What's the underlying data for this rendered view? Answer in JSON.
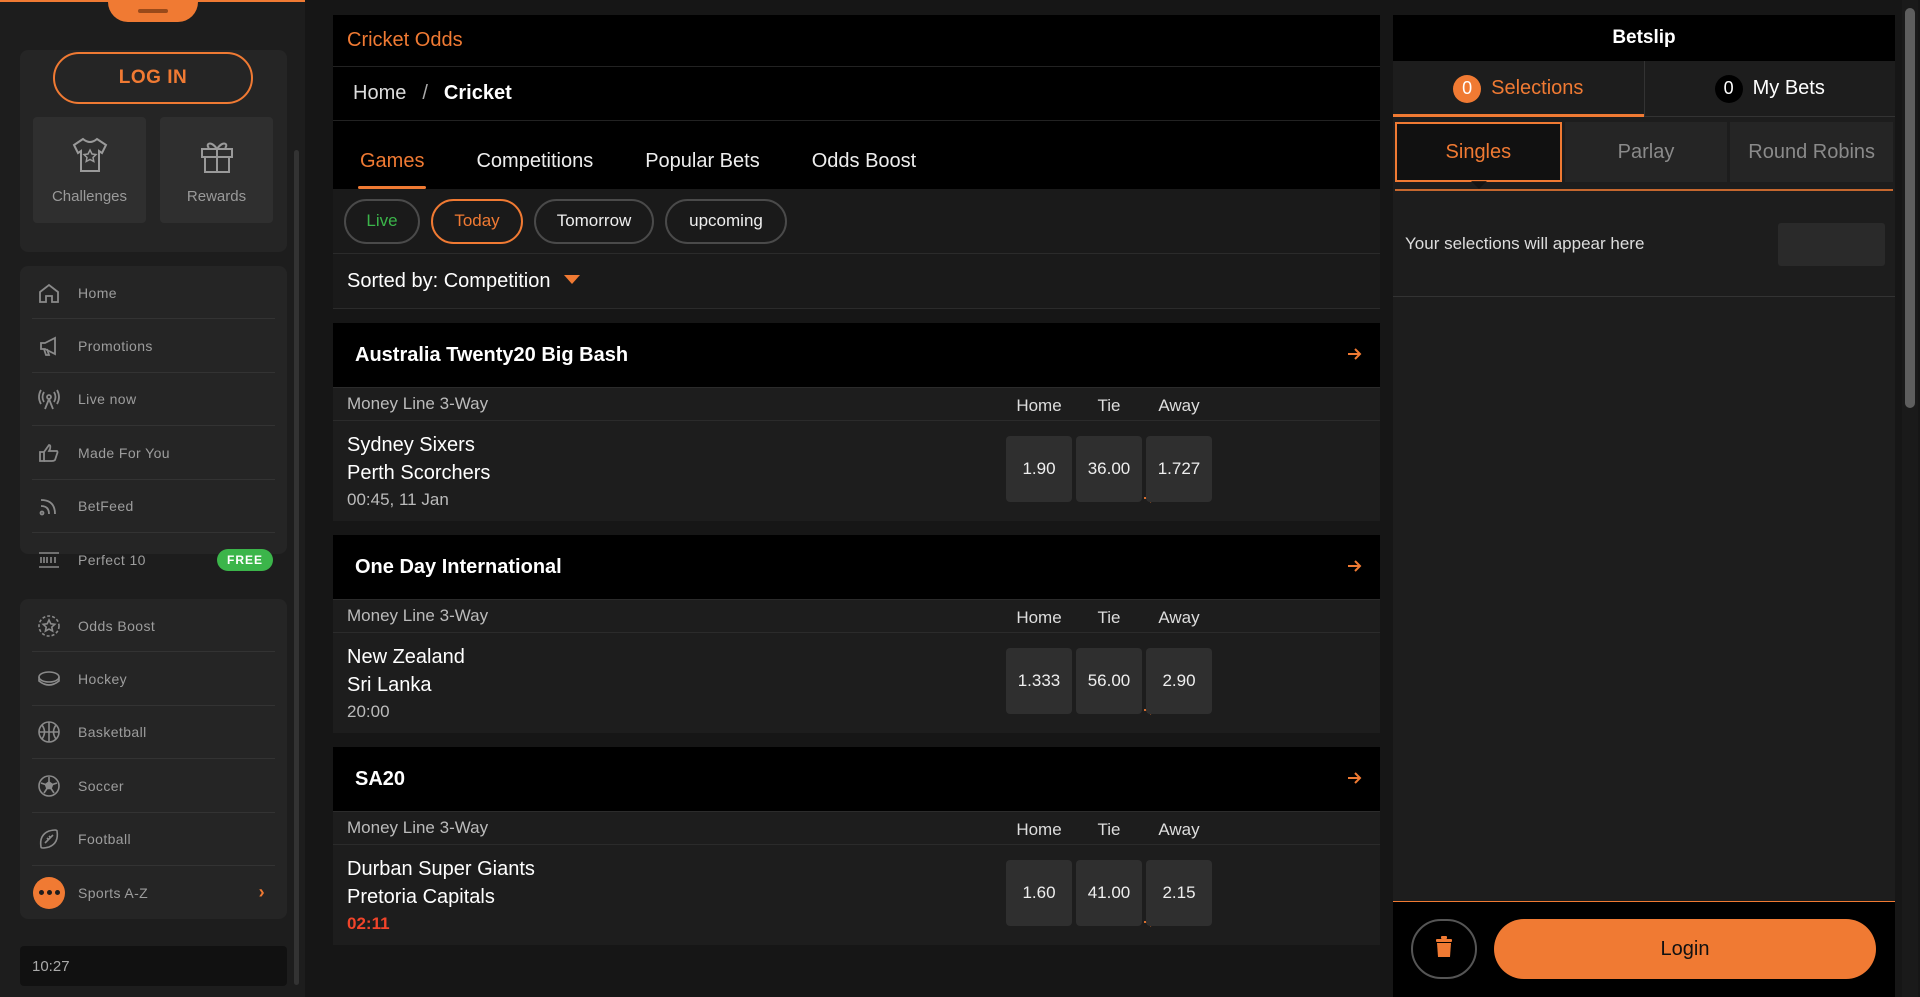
{
  "sidebar": {
    "login_label": "LOG IN",
    "tiles": [
      {
        "label": "Challenges",
        "icon": "shirt-icon"
      },
      {
        "label": "Rewards",
        "icon": "gift-icon"
      }
    ],
    "nav_primary": [
      {
        "label": "Home",
        "icon": "home-icon"
      },
      {
        "label": "Promotions",
        "icon": "megaphone-icon"
      },
      {
        "label": "Live now",
        "icon": "broadcast-icon"
      },
      {
        "label": "Made For You",
        "icon": "thumbs-up-icon"
      },
      {
        "label": "BetFeed",
        "icon": "rss-icon"
      },
      {
        "label": "Perfect 10",
        "icon": "perfect10-icon",
        "badge": "FREE"
      }
    ],
    "nav_sports": [
      {
        "label": "Odds Boost",
        "icon": "odds-boost-icon"
      },
      {
        "label": "Hockey",
        "icon": "hockey-icon"
      },
      {
        "label": "Basketball",
        "icon": "basketball-icon"
      },
      {
        "label": "Soccer",
        "icon": "soccer-icon"
      },
      {
        "label": "Football",
        "icon": "football-icon"
      },
      {
        "label": "Sports A-Z",
        "icon": "more-dots-icon"
      }
    ],
    "clock": "10:27"
  },
  "main": {
    "title": "Cricket Odds",
    "breadcrumb": {
      "home": "Home",
      "sep": "/",
      "current": "Cricket"
    },
    "tabs": [
      "Games",
      "Competitions",
      "Popular Bets",
      "Odds Boost"
    ],
    "filters": [
      "Live",
      "Today",
      "Tomorrow",
      "upcoming"
    ],
    "sort_label": "Sorted by: Competition",
    "competitions": [
      {
        "name": "Australia Twenty20 Big Bash",
        "market": "Money Line 3-Way",
        "cols": [
          "Home",
          "Tie",
          "Away"
        ],
        "home_team": "Sydney Sixers",
        "away_team": "Perth Scorchers",
        "time": "00:45, 11 Jan",
        "odds": [
          "1.90",
          "36.00",
          "1.727"
        ]
      },
      {
        "name": "One Day International",
        "market": "Money Line 3-Way",
        "cols": [
          "Home",
          "Tie",
          "Away"
        ],
        "home_team": "New Zealand",
        "away_team": "Sri Lanka",
        "time": "20:00",
        "odds": [
          "1.333",
          "56.00",
          "2.90"
        ]
      },
      {
        "name": "SA20",
        "market": "Money Line 3-Way",
        "cols": [
          "Home",
          "Tie",
          "Away"
        ],
        "home_team": "Durban Super Giants",
        "away_team": "Pretoria Capitals",
        "time": "02:11",
        "odds": [
          "1.60",
          "41.00",
          "2.15"
        ]
      }
    ]
  },
  "betslip": {
    "title": "Betslip",
    "tabs": [
      {
        "count": "0",
        "label": "Selections"
      },
      {
        "count": "0",
        "label": "My Bets"
      }
    ],
    "bet_types": [
      "Singles",
      "Parlay",
      "Round Robins"
    ],
    "empty_message": "Your selections will appear here",
    "login_label": "Login"
  },
  "colors": {
    "accent": "#f07a33",
    "live": "#3bb54a",
    "live_time": "#f0442a"
  }
}
